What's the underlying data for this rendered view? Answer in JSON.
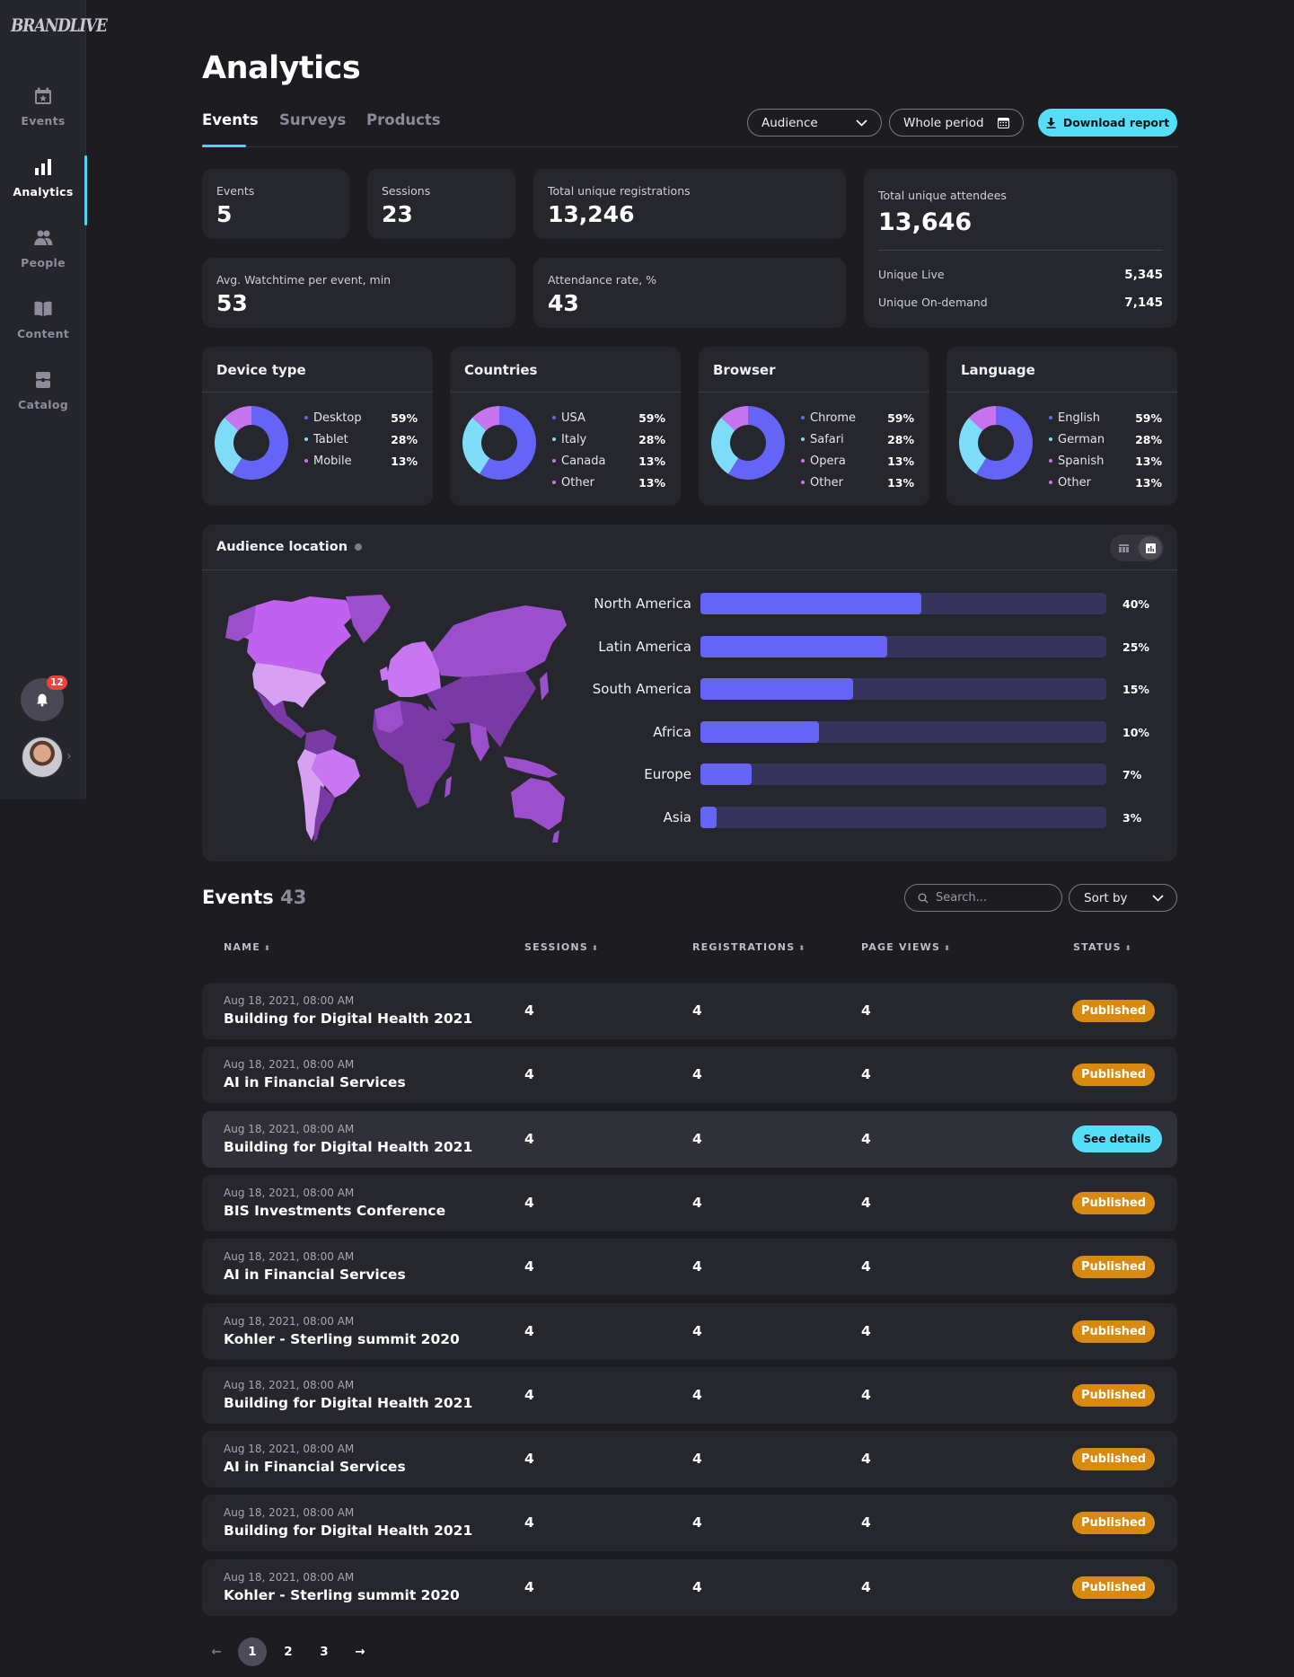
{
  "brand": {
    "logo_text": "BRANDLIVE"
  },
  "sidebar": {
    "items": [
      {
        "label": "Events",
        "icon": "calendar-star-icon",
        "active": false
      },
      {
        "label": "Analytics",
        "icon": "bar-chart-icon",
        "active": true
      },
      {
        "label": "People",
        "icon": "people-icon",
        "active": false
      },
      {
        "label": "Content",
        "icon": "book-icon",
        "active": false
      },
      {
        "label": "Catalog",
        "icon": "catalog-box-icon",
        "active": false
      }
    ],
    "notifications_count": "12",
    "avatar_icon": "user-avatar"
  },
  "header": {
    "title": "Analytics",
    "tabs": [
      {
        "label": "Events",
        "active": true
      },
      {
        "label": "Surveys",
        "active": false
      },
      {
        "label": "Products",
        "active": false
      }
    ],
    "audience_select": "Audience",
    "period_select": "Whole period",
    "download_label": "Download report"
  },
  "stats": {
    "events": {
      "label": "Events",
      "value": "5"
    },
    "sessions": {
      "label": "Sessions",
      "value": "23"
    },
    "registrations": {
      "label": "Total unique registrations",
      "value": "13,246"
    },
    "watchtime": {
      "label": "Avg. Watchtime per event, min",
      "value": "53"
    },
    "attendance": {
      "label": "Attendance rate, %",
      "value": "43"
    },
    "attendees": {
      "label": "Total unique attendees",
      "value": "13,646",
      "live_label": "Unique Live",
      "live_value": "5,345",
      "ondemand_label": "Unique On-demand",
      "ondemand_value": "7,145"
    }
  },
  "colors": {
    "accent": "#55def7",
    "slice1": "#6664f6",
    "slice2": "#7fdcf9",
    "slice3": "#c874ef",
    "slice4": "#c874ef",
    "published": "#d88a10"
  },
  "chart_data": [
    {
      "type": "pie",
      "title": "Device type",
      "categories": [
        "Desktop",
        "Tablet",
        "Mobile"
      ],
      "values": [
        59,
        28,
        13
      ],
      "labels": [
        "59%",
        "28%",
        "13%"
      ]
    },
    {
      "type": "pie",
      "title": "Countries",
      "categories": [
        "USA",
        "Italy",
        "Canada",
        "Other"
      ],
      "values": [
        59,
        28,
        13,
        13
      ],
      "labels": [
        "59%",
        "28%",
        "13%",
        "13%"
      ]
    },
    {
      "type": "pie",
      "title": "Browser",
      "categories": [
        "Chrome",
        "Safari",
        "Opera",
        "Other"
      ],
      "values": [
        59,
        28,
        13,
        13
      ],
      "labels": [
        "59%",
        "28%",
        "13%",
        "13%"
      ]
    },
    {
      "type": "pie",
      "title": "Language",
      "categories": [
        "English",
        "German",
        "Spanish",
        "Other"
      ],
      "values": [
        59,
        28,
        13,
        13
      ],
      "labels": [
        "59%",
        "28%",
        "13%",
        "13%"
      ]
    },
    {
      "type": "bar",
      "title": "Audience location",
      "categories": [
        "North America",
        "Latin America",
        "South America",
        "Africa",
        "Europe",
        "Asia"
      ],
      "values": [
        40,
        25,
        15,
        10,
        7,
        3
      ],
      "labels": [
        "40%",
        "25%",
        "15%",
        "10%",
        "7%",
        "3%"
      ],
      "orientation": "horizontal"
    }
  ],
  "audience_location": {
    "title": "Audience location",
    "view_options": [
      "table-view",
      "chart-view"
    ],
    "selected_view": "chart-view"
  },
  "events_list": {
    "title": "Events",
    "count": "43",
    "search_placeholder": "Search...",
    "sort_label": "Sort by",
    "columns": [
      "NAME",
      "SESSIONS",
      "REGISTRATIONS",
      "PAGE VIEWS",
      "STATUS"
    ],
    "rows": [
      {
        "date": "Aug 18, 2021, 08:00 AM",
        "name": "Building for Digital Health 2021",
        "sessions": "4",
        "registrations": "4",
        "page_views": "4",
        "status": "Published"
      },
      {
        "date": "Aug 18, 2021, 08:00 AM",
        "name": "AI in Financial Services",
        "sessions": "4",
        "registrations": "4",
        "page_views": "4",
        "status": "Published"
      },
      {
        "date": "Aug 18, 2021, 08:00 AM",
        "name": "Building for Digital Health 2021",
        "sessions": "4",
        "registrations": "4",
        "page_views": "4",
        "status": "See details",
        "hover": true
      },
      {
        "date": "Aug 18, 2021, 08:00 AM",
        "name": "BIS Investments Conference",
        "sessions": "4",
        "registrations": "4",
        "page_views": "4",
        "status": "Published"
      },
      {
        "date": "Aug 18, 2021, 08:00 AM",
        "name": "AI in Financial Services",
        "sessions": "4",
        "registrations": "4",
        "page_views": "4",
        "status": "Published"
      },
      {
        "date": "Aug 18, 2021, 08:00 AM",
        "name": "Kohler - Sterling summit 2020",
        "sessions": "4",
        "registrations": "4",
        "page_views": "4",
        "status": "Published"
      },
      {
        "date": "Aug 18, 2021, 08:00 AM",
        "name": "Building for Digital Health 2021",
        "sessions": "4",
        "registrations": "4",
        "page_views": "4",
        "status": "Published"
      },
      {
        "date": "Aug 18, 2021, 08:00 AM",
        "name": "AI in Financial Services",
        "sessions": "4",
        "registrations": "4",
        "page_views": "4",
        "status": "Published"
      },
      {
        "date": "Aug 18, 2021, 08:00 AM",
        "name": "Building for Digital Health 2021",
        "sessions": "4",
        "registrations": "4",
        "page_views": "4",
        "status": "Published"
      },
      {
        "date": "Aug 18, 2021, 08:00 AM",
        "name": "Kohler - Sterling summit 2020",
        "sessions": "4",
        "registrations": "4",
        "page_views": "4",
        "status": "Published"
      }
    ]
  },
  "pagination": {
    "prev": "←",
    "pages": [
      "1",
      "2",
      "3"
    ],
    "current": "1",
    "next": "→"
  }
}
